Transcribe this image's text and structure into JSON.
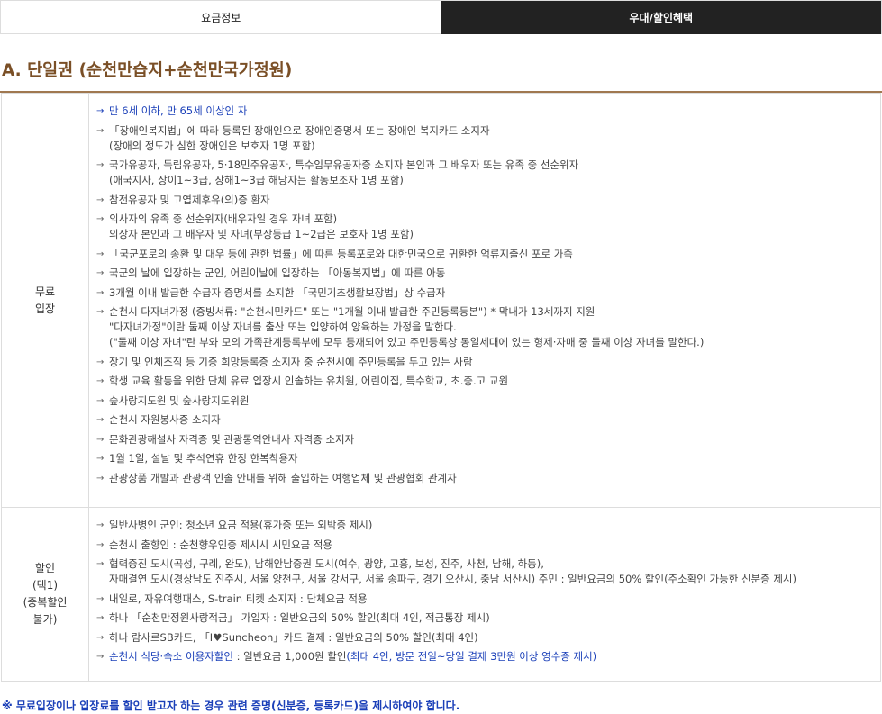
{
  "tabs": [
    {
      "label": "요금정보"
    },
    {
      "label": "우대/할인혜택"
    }
  ],
  "section": {
    "title": "A. 단일권 (순천만습지+순천만국가정원)"
  },
  "free_admission": {
    "category_lines": [
      "무료",
      "입장"
    ],
    "items": [
      [
        "만 6세 이하, 만 65세 이상인 자"
      ],
      [
        "「장애인복지법」에 따라 등록된 장애인으로 장애인증명서 또는 장애인 복지카드 소지자",
        "(장애의 정도가 심한 장애인은 보호자 1명 포함)"
      ],
      [
        "국가유공자, 독립유공자, 5·18민주유공자, 특수임무유공자증 소지자 본인과 그 배우자 또는 유족 중 선순위자",
        "(애국지사, 상이1~3급, 장해1~3급 해당자는 활동보조자 1명 포함)"
      ],
      [
        "참전유공자 및 고엽제후유(의)증 환자"
      ],
      [
        "의사자의 유족 중 선순위자(배우자일 경우 자녀 포함)",
        "의상자 본인과 그 배우자 및 자녀(부상등급 1~2급은 보호자 1명 포함)"
      ],
      [
        "「국군포로의 송환 및 대우 등에 관한 법률」에 따른 등록포로와 대한민국으로 귀환한 억류지출신 포로 가족"
      ],
      [
        "국군의 날에 입장하는 군인, 어린이날에 입장하는 「아동복지법」에 따른 아동"
      ],
      [
        "3개월 이내 발급한 수급자 증명서를 소지한 「국민기초생활보장법」상 수급자"
      ],
      [
        "순천시 다자녀가정 (증빙서류: \"순천시민카드\" 또는 \"1개월 이내 발급한 주민등록등본\") * 막내가 13세까지 지원",
        "\"다자녀가정\"이란 둘째 이상 자녀를 출산 또는 입양하여 양육하는 가정을 말한다.",
        "(\"둘째 이상 자녀\"란 부와 모의 가족관계등록부에 모두 등재되어 있고 주민등록상 동일세대에 있는 형제·자매 중 둘째 이상 자녀를 말한다.)"
      ],
      [
        "장기 및 인체조직 등 기증 희망등록증 소지자 중 순천시에 주민등록을 두고 있는 사람"
      ],
      [
        "학생 교육 활동을 위한 단체 유료 입장시 인솔하는 유치원, 어린이집, 특수학교, 초.중.고 교원"
      ],
      [
        "숲사랑지도원 및 숲사랑지도위원"
      ],
      [
        "순천시 자원봉사증 소지자"
      ],
      [
        "문화관광해설사 자격증 및 관광통역안내사 자격증 소지자"
      ],
      [
        "1월 1일, 설날 및 추석연휴 한정 한복착용자"
      ],
      [
        "관광상품 개발과 관광객 인솔 안내를 위해 출입하는 여행업체 및 관광협회 관계자"
      ]
    ]
  },
  "discount": {
    "category_lines": [
      "할인",
      "(택1)",
      "(중복할인",
      "불가)"
    ],
    "items": [
      [
        "일반사병인 군인: 청소년 요금 적용(휴가증 또는 외박증 제시)"
      ],
      [
        "순천시 출향인 : 순천향우인증 제시시 시민요금 적용"
      ],
      [
        "협력증진 도시(곡성, 구례, 완도), 남해안남중권 도시(여수, 광양, 고흥, 보성, 진주, 사천, 남해, 하동),",
        "자매결연 도시(경상남도 진주시, 서울 양천구, 서울 강서구, 서울 송파구, 경기 오산시, 충남 서산시) 주민 : 일반요금의 50% 할인(주소확인 가능한 신분증 제시)"
      ],
      [
        "내일로, 자유여행패스, S-train 티켓 소지자 : 단체요금 적용"
      ],
      [
        "하나 「순천만정원사랑적금」 가입자 : 일반요금의 50% 할인(최대 4인, 적금통장 제시)"
      ],
      [
        "하나 람사르SB카드, 「I♥Suncheon」카드 결제 : 일반요금의 50% 할인(최대 4인)"
      ]
    ],
    "last_item": {
      "part1": "순천시 식당·숙소 이용자할인",
      "part2": " : 일반요금 1,000원 할인",
      "part3": "(최대 4인, 방문 전일~당일 결제 3만원 이상 영수증 제시)"
    }
  },
  "notice": "※ 무료입장이나 입장료를 할인 받고자 하는 경우 관련 증명(신분증, 등록카드)을 제시하여야 합니다.",
  "icons": {
    "bullet": "arrow-bullet-icon"
  },
  "colors": {
    "title": "#7a4f26",
    "highlight": "#1a3fb8",
    "active_tab": "#222222"
  }
}
